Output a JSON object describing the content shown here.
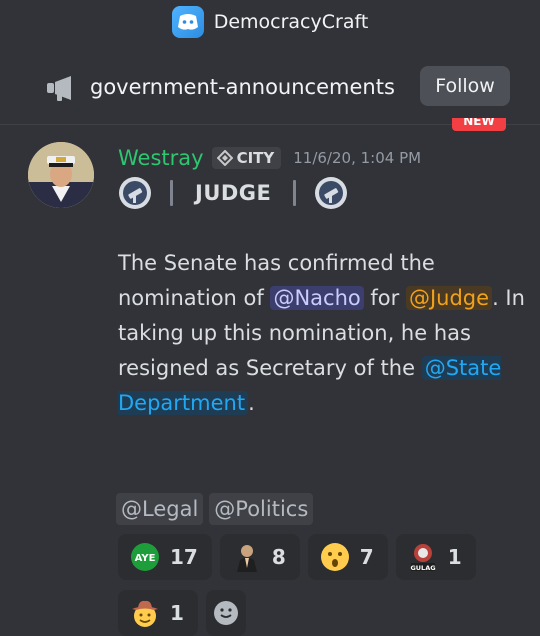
{
  "server": {
    "name": "DemocracyCraft",
    "icon": "server-discord-icon"
  },
  "channel": {
    "name": "government-announcements",
    "icon": "megaphone-icon",
    "follow_label": "Follow",
    "new_badge": "NEW"
  },
  "message": {
    "author": "Westray",
    "author_color": "#2dc770",
    "tag": {
      "label": "CITY",
      "icon": "diamond-icon"
    },
    "timestamp": "11/6/20, 1:04 PM",
    "header_line": {
      "label": "JUDGE",
      "left_emoji": "gov-seal-icon",
      "right_emoji": "gov-seal-icon"
    },
    "body": {
      "t1": "The Senate has confirmed the nomination of ",
      "m1": "@Nacho",
      "t2": " for ",
      "m2": "@Judge",
      "t3": ". In taking up this nomination, he has resigned as Secretary of the ",
      "m3": "@State Department",
      "t4": "."
    },
    "role_mentions": [
      "@Legal",
      "@Politics"
    ]
  },
  "reactions": [
    {
      "emoji": "aye-icon",
      "count": "17"
    },
    {
      "emoji": "praying-man-icon",
      "count": "8"
    },
    {
      "emoji": "surprised-face-icon",
      "count": "7"
    },
    {
      "emoji": "gulag-icon",
      "count": "1"
    },
    {
      "emoji": "cowboy-face-icon",
      "count": "1"
    }
  ],
  "add_reaction_icon": "add-reaction-icon",
  "colors": {
    "background": "#313338",
    "mention_user": "#c9cdfb",
    "mention_judge": "#f1a21b",
    "mention_state": "#22a8f2"
  }
}
